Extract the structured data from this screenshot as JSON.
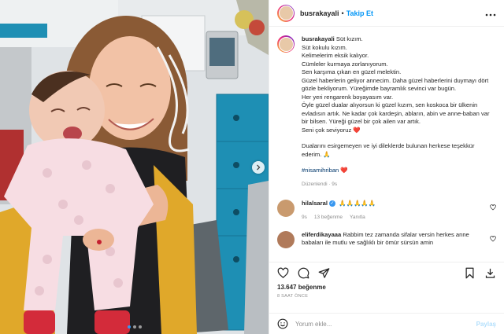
{
  "header": {
    "username": "busrakayali",
    "separator": "•",
    "follow_label": "Takip Et",
    "more_icon": "more-horizontal-icon"
  },
  "caption": {
    "username": "busrakayali",
    "lines": [
      "Süt kızım.",
      "Süt kokulu kızım.",
      "Kelimelerim eksik kalıyor.",
      "Cümleler kurmaya zorlanıyorum.",
      "Sen karşıma çıkan en güzel melektin.",
      "Güzel haberlerin geliyor annecim. Daha güzel haberlerini duymayı dört gözle bekliyorum. Yüreğimde bayramlık sevinci var bugün.",
      "Her yeri rengarenk boyayasım var.",
      "Öyle güzel dualar alıyorsun ki güzel kızım, sen koskoca bir ülkenin evladısın artık. Ne kadar çok kardeşin, abların, abin ve anne-baban var bir bilsen. Yüreği güzel bir çok ailen var artık.",
      "Seni çok seviyoruz ❤️"
    ],
    "paragraph2": "Dualarını esirgemeyen ve iyi dileklerde bulunan herkese teşekkür ederim. 🙏",
    "hashtag": "#nisamihriban",
    "hashtag_suffix": "❤️",
    "edited": "Düzenlendi · 9s"
  },
  "comments": [
    {
      "username": "hilalsaral",
      "verified": true,
      "text": "🙏🙏🙏🙏🙏",
      "age": "9s",
      "likes": "13 beğenme",
      "reply": "Yanıtla"
    },
    {
      "username": "eliferdikayaaa",
      "verified": false,
      "text": "Rabbim tez zamanda sifalar versin herkes anne babaları ile mutlu ve sağlıklı bir ömür sürsün amin"
    }
  ],
  "actions": {
    "likes": "13.647 beğenme",
    "timestamp": "8 SAAT ÖNCE"
  },
  "add_comment": {
    "placeholder": "Yorum ekle...",
    "post_label": "Paylaş"
  },
  "colors": {
    "accent": "#0095f6",
    "heart": "#ed4956",
    "muted": "#8e8e8e"
  }
}
